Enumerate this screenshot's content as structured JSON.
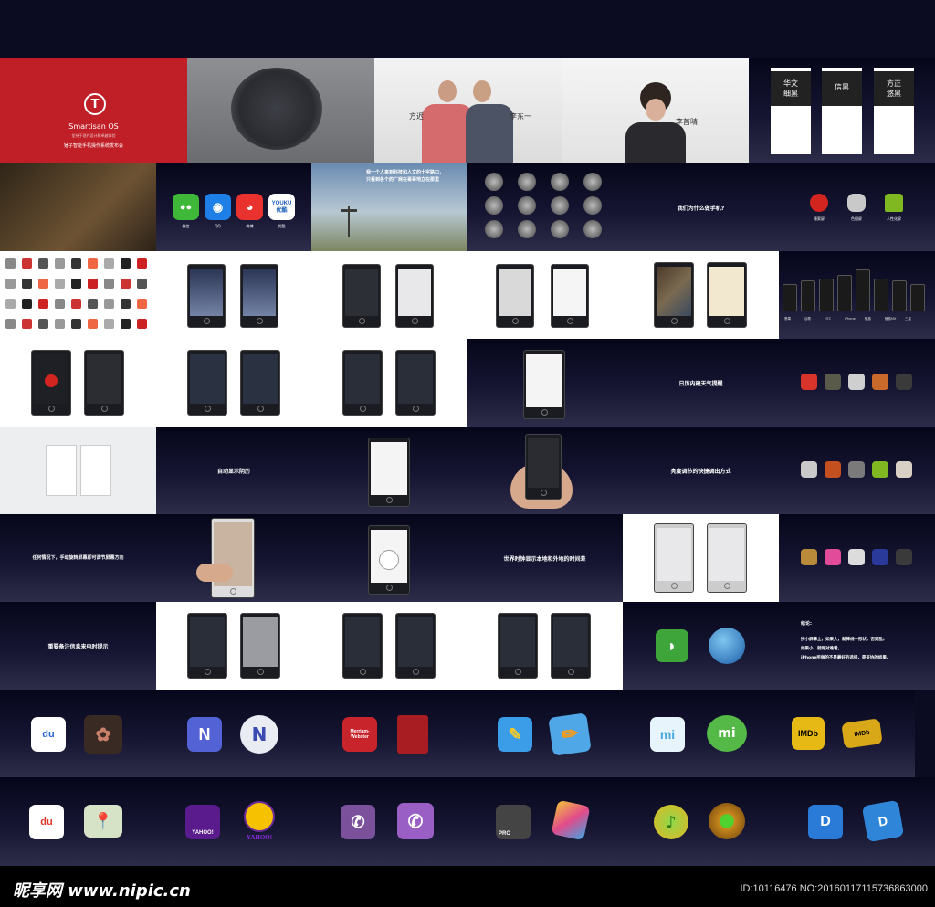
{
  "row1": {
    "logo_title": "Smartisan OS",
    "logo_subtitle": "坚持于现代设计和卓越体验",
    "logo_tagline": "锤子智能手机操作系统发布会",
    "person1": "方迟",
    "person2": "李东一",
    "person3": "李首晴",
    "cards": [
      "华文\n细黑",
      "信黑",
      "方正\n悠黑"
    ]
  },
  "row2": {
    "apps": [
      "微信",
      "QQ",
      "微博",
      "优酷"
    ],
    "youku_logo": "YOUKU\n优酷",
    "slogan": "我一个人来到科技和人文的十字路口，\n只看到各个的厂商在哥哥地立在那里",
    "question": "我们为什么做手机?",
    "icons3": [
      "锤索屏",
      "色图屏",
      "人性化屏"
    ]
  },
  "row3": {
    "devices_labels": [
      "黑莓",
      "谷歌",
      "HTC",
      "iPhone",
      "魅族",
      "魅族MX",
      "三星"
    ]
  },
  "row4": {
    "weather_caption": "日历内建天气提醒"
  },
  "row5": {
    "calendar_caption": "自动显示阴历",
    "brightness_caption": "亮度调节的快捷调出方式"
  },
  "row6": {
    "rotate_caption": "任何情况下，手动旋转屏幕即可调节屏幕方向",
    "clock_caption": "世界时钟显示本地和外地的时间差"
  },
  "row7": {
    "note_caption": "重要备注信息来电时提示",
    "conclusion_title": "结论:",
    "conclusion_line1": "拼小屏幕上，如果大，就摔线一形状，否则乱;",
    "conclusion_line2": "如果小，就呢对难看。",
    "conclusion_line3": "iPhone所做的不是最好的选择，是妥协的结果。"
  },
  "row8": {
    "badges": [
      "du",
      "N",
      "Merriam-\nWebster",
      "mi",
      "IMDb"
    ]
  },
  "row9": {
    "badges": [
      "du",
      "YAHOO!",
      "PRO"
    ]
  },
  "footer": {
    "brand": "昵享网 www.nipic.cn",
    "id": "ID:10116476 NO:20160117115736863000"
  },
  "colors": {
    "red_tile": "#c01f27",
    "dark_bg": "#0b0b22",
    "wechat": "#3fb83a",
    "qq": "#1e80e6",
    "weibo": "#e9322d",
    "imdb": "#e7b915"
  }
}
